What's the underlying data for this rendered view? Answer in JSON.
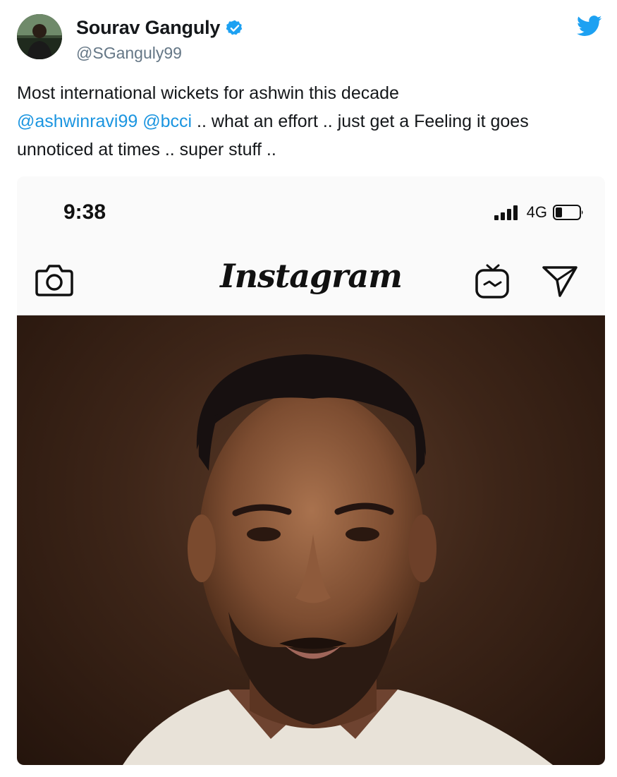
{
  "tweet": {
    "author": {
      "display_name": "Sourav Ganguly",
      "handle": "@SGanguly99",
      "verified": true
    },
    "text_parts": [
      "Most international wickets for ashwin this decade",
      "@ashwinravi99",
      "@bcci",
      ".. what an effort .. just get a Feeling it goes unnoticed at times .. super stuff .."
    ],
    "mentions": [
      "@ashwinravi99",
      "@bcci"
    ]
  },
  "embedded_screenshot": {
    "status_bar": {
      "time": "9:38",
      "network": "4G"
    },
    "app_header": {
      "logo_text": "Instagram",
      "icons": [
        "camera-icon",
        "igtv-icon",
        "direct-message-icon"
      ]
    }
  },
  "icons": [
    "verified-badge-icon",
    "twitter-bird-icon",
    "signal-icon",
    "battery-icon"
  ],
  "colors": {
    "link": "#1b95e0",
    "verified": "#1da1f2",
    "twitter_brand": "#1da1f2",
    "handle": "#657786"
  }
}
